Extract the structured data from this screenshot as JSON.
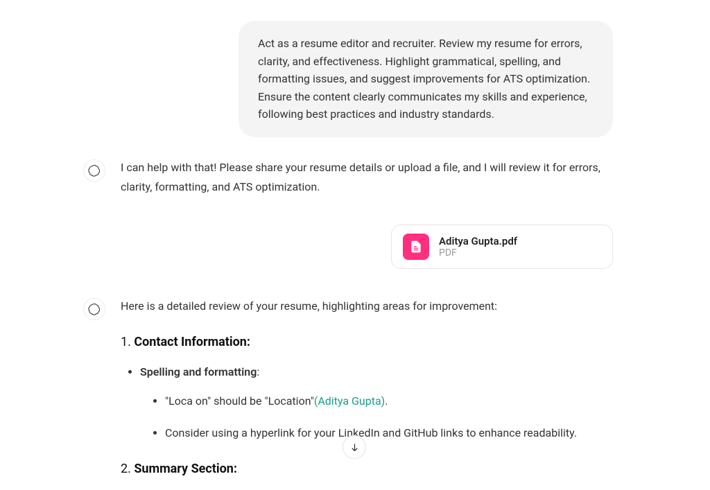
{
  "messages": {
    "user_prompt": "Act as a resume editor and recruiter. Review my resume for errors, clarity, and effectiveness. Highlight grammatical, spelling, and formatting issues, and suggest improvements for ATS optimization. Ensure the content clearly communicates my skills and experience, following best practices and industry standards.",
    "assistant_reply_1": "I can help with that! Please share your resume details or upload a file, and I will review it for errors, clarity, formatting, and ATS optimization."
  },
  "attachment": {
    "filename": "Aditya Gupta.pdf",
    "filetype": "PDF"
  },
  "review": {
    "intro": "Here is a detailed review of your resume, highlighting areas for improvement:",
    "section1": {
      "number": "1. ",
      "title": "Contact Information:",
      "bullet_label": "Spelling and formatting",
      "bullet_colon": ":",
      "sub1_prefix": "\"Loca on\" should be \"Location\"",
      "sub1_cite": "(Aditya Gupta)",
      "sub1_suffix": ".",
      "sub2": "Consider using a hyperlink for your LinkedIn and GitHub links to enhance readability."
    },
    "section2": {
      "number": "2. ",
      "title": "Summary Section:"
    }
  }
}
